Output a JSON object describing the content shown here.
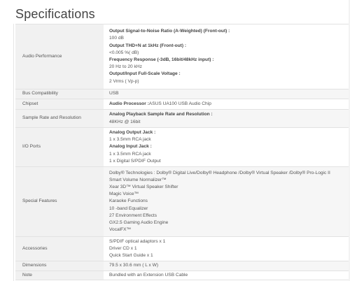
{
  "page": {
    "title": "Specifications"
  },
  "specs": {
    "audio_performance": {
      "label": "Audio Performance",
      "lines": [
        "Output Signal-to-Noise Ratio (A-Weighted) (Front-out) :",
        "100 dB",
        "Output THD+N at 1kHz (Front-out) :",
        "<0.005 %( dB)",
        "Frequency Response (-3dB, 16bit/48kHz input) :",
        "20 Hz to 20 kHz",
        "Output/Input Full-Scale Voltage :",
        "2 Vrms ( Vp-p)"
      ]
    },
    "bus_compatibility": {
      "label": "Bus Compatibility",
      "value": "USB"
    },
    "chipset": {
      "label": "Chipset",
      "value_bold": "Audio Processor :",
      "value_rest": "ASUS UA100 USB Audio Chip"
    },
    "sample_rate": {
      "label": "Sample Rate and Resolution",
      "lines": [
        "Analog Playback Sample Rate and Resolution :",
        "48KHz @ 16bit"
      ]
    },
    "io_ports": {
      "label": "I/O Ports",
      "lines": [
        "Analog Output Jack :",
        "1 x 3.5mm RCA jack",
        "Analog Input Jack :",
        "1 x 3.5mm RCA jack",
        "1 x Digital S/PDIF Output"
      ]
    },
    "special_features": {
      "label": "Special Features",
      "lines": [
        "Dolby® Technologies : Dolby® Digital Live/Dolby® Headphone /Dolby® Virtual Speaker /Dolby® Pro-Logic II",
        "Smart Volume Normalizer™",
        "Xear 3D™ Virtual Speaker Shifter",
        "Magic Voice™",
        "Karaoke Functions",
        "10 -band Equalizer",
        "27 Environment Effects",
        "GX2.5 Gaming Audio Engine",
        "VocalFX™"
      ]
    },
    "accessories": {
      "label": "Accessories",
      "lines": [
        "S/PDIF optical adaptors x 1",
        "Driver CD x 1",
        "Quick Start Guide x 1"
      ]
    },
    "dimensions": {
      "label": "Dimensions",
      "value": "79.5 x 30.6 mm ( L x W)"
    },
    "note": {
      "label": "Note",
      "value": "Bundled with an Extension USB Cable"
    }
  }
}
